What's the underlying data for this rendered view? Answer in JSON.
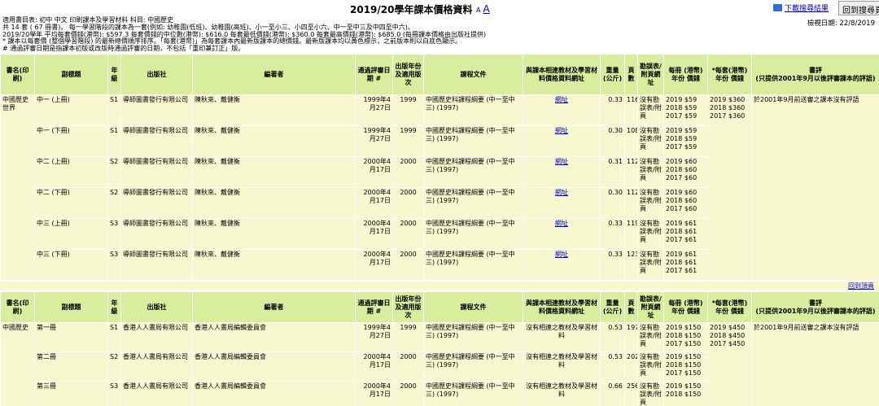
{
  "header": {
    "title": "2019/20學年課本價格資料",
    "font_small": "A",
    "font_large": "A",
    "download_label": "下載搜尋結果",
    "back_label": "回到搜尋頁",
    "check_date": "檢視日期: 22/8/2019"
  },
  "info": {
    "line1": "適用書目表:  初中 中文 印刷課本及學習材料     科目:  中國歷史",
    "line2": "共 14 套 ( 67 冊書)。     每一學習階段的課本為一套(例如: 幼稚園(低班)、幼稚園(高班)、小一至小三、小四至小六、中一至中三及中四至中六)。",
    "line3": "2019/20學年 平均每套價錢(港幣): $597.3     每套價錢的中位數(港幣): $616.0     每套最低價錢(港幣): $360.0     每套最高價錢(港幣): $685.0     (每冊課本價格由出版社提供)",
    "line4": "* 課本以每套價 (整個學習階段) 的最新總價順序排序。「每套(港幣)」為每套課本內最新版課本的總價錢。最新版課本均以黃色標示，之前版本則以白底色顯示。",
    "line5": "# 通過評審日期是指課本初版或改版時通過評審的日期，不包括「重印兼訂正」版。"
  },
  "columns": [
    "書名(印刷)",
    "副標題",
    "年級",
    "出版社",
    "編著者",
    "通過評審日期 #",
    "出版年份及適用版次",
    "課程文件",
    "與課本相連教材及學習材料價格資料網址",
    "重量(公斤)",
    "頁數",
    "勘誤表/附頁網址",
    "每冊 (港幣)",
    "年份",
    "價錢",
    "*每套(港幣)",
    "年份",
    "價錢",
    "書評\n(只提供2001年9月以後評審課本的評語)"
  ],
  "table1": {
    "book": "中國歷史世界",
    "review": "於2001年9月前送審之課本沒有評語",
    "set_prices": [
      [
        "2019",
        "$360"
      ],
      [
        "2018",
        "$360"
      ],
      [
        "2017",
        "$360"
      ]
    ],
    "rows": [
      {
        "sub": "中一 (上冊)",
        "grade": "S1",
        "pub": "導師圖書發行有限公司",
        "author": "陳秋來、戴健衡",
        "date": "1999年4月27日",
        "year": "1999",
        "curr": "中國歷史科課程綱要 (中一至中三) (1997)",
        "link": "網址",
        "weight": "0.33",
        "pages": "116",
        "err": "沒有勘誤表/附頁",
        "prices": [
          [
            "2019",
            "$59"
          ],
          [
            "2018",
            "$59"
          ],
          [
            "2017",
            "$59"
          ]
        ]
      },
      {
        "sub": "中一 (下冊)",
        "grade": "S1",
        "pub": "導師圖書發行有限公司",
        "author": "陳秋來、戴健衡",
        "date": "1999年4月27日",
        "year": "1999",
        "curr": "中國歷史科課程綱要 (中一至中三) (1997)",
        "link": "網址",
        "weight": "0.30",
        "pages": "108",
        "err": "沒有勘誤表/附頁",
        "prices": [
          [
            "2019",
            "$59"
          ],
          [
            "2018",
            "$59"
          ],
          [
            "2017",
            "$59"
          ]
        ]
      },
      {
        "sub": "中二 (上冊)",
        "grade": "S2",
        "pub": "導師圖書發行有限公司",
        "author": "陳秋來、戴健衡",
        "date": "2000年4月17日",
        "year": "2000",
        "curr": "中國歷史科課程綱要 (中一至中三) (1997)",
        "link": "網址",
        "weight": "0.31",
        "pages": "112",
        "err": "沒有勘誤表/附頁",
        "prices": [
          [
            "2019",
            "$60"
          ],
          [
            "2018",
            "$60"
          ],
          [
            "2017",
            "$60"
          ]
        ]
      },
      {
        "sub": "中二 (下冊)",
        "grade": "S2",
        "pub": "導師圖書發行有限公司",
        "author": "陳秋來、戴健衡",
        "date": "2000年4月17日",
        "year": "2000",
        "curr": "中國歷史科課程綱要 (中一至中三) (1997)",
        "link": "網址",
        "weight": "0.30",
        "pages": "112",
        "err": "沒有勘誤表/附頁",
        "prices": [
          [
            "2019",
            "$60"
          ],
          [
            "2018",
            "$60"
          ],
          [
            "2017",
            "$60"
          ]
        ]
      },
      {
        "sub": "中三 (上冊)",
        "grade": "S3",
        "pub": "導師圖書發行有限公司",
        "author": "陳秋來、戴健衡",
        "date": "2000年4月17日",
        "year": "2000",
        "curr": "中國歷史科課程綱要 (中一至中三) (1997)",
        "link": "網址",
        "weight": "0.33",
        "pages": "119",
        "err": "沒有勘誤表/附頁",
        "prices": [
          [
            "2019",
            "$61"
          ],
          [
            "2018",
            "$61"
          ],
          [
            "2017",
            "$61"
          ]
        ]
      },
      {
        "sub": "中三 (下冊)",
        "grade": "S3",
        "pub": "導師圖書發行有限公司",
        "author": "陳秋來、戴健衡",
        "date": "2000年4月17日",
        "year": "2000",
        "curr": "中國歷史科課程綱要 (中一至中三) (1997)",
        "link": "網址",
        "weight": "0.33",
        "pages": "123",
        "err": "沒有勘誤表/附頁",
        "prices": [
          [
            "2019",
            "$61"
          ],
          [
            "2018",
            "$61"
          ],
          [
            "2017",
            "$61"
          ]
        ]
      }
    ]
  },
  "back_to_top": "回到頂頁",
  "table2": {
    "book": "中國歷史",
    "review": "於2001年9月前送審之課本沒有評語",
    "set_prices": [
      [
        "2019",
        "$450"
      ],
      [
        "2018",
        "$450"
      ],
      [
        "2017",
        "$450"
      ]
    ],
    "rows": [
      {
        "sub": "第一冊",
        "grade": "S1",
        "pub": "香港人人書局有限公司",
        "author": "香港人人書局編輯委員會",
        "date": "1999年4月27日",
        "year": "1999",
        "curr": "中國歷史科課程綱要 (中一至中三) (1997)",
        "link": "沒有相連之教材及學習材料",
        "weight": "0.53",
        "pages": "197",
        "err": "沒有勘誤表/附頁",
        "prices": [
          [
            "2019",
            "$150"
          ],
          [
            "2018",
            "$150"
          ],
          [
            "2017",
            "$150"
          ]
        ]
      },
      {
        "sub": "第二冊",
        "grade": "S2",
        "pub": "香港人人書局有限公司",
        "author": "香港人人書局編輯委員會",
        "date": "2000年4月17日",
        "year": "2000",
        "curr": "中國歷史科課程綱要 (中一至中三) (1997)",
        "link": "沒有相連之教材及學習材料",
        "weight": "0.53",
        "pages": "202",
        "err": "沒有勘誤表/附頁",
        "prices": [
          [
            "2019",
            "$150"
          ],
          [
            "2018",
            "$150"
          ],
          [
            "2017",
            "$150"
          ]
        ]
      },
      {
        "sub": "第三冊",
        "grade": "S3",
        "pub": "香港人人書局有限公司",
        "author": "香港人人書局編輯委員會",
        "date": "2000年4月17日",
        "year": "2000",
        "curr": "中國歷史科課程綱要 (中一至中三) (1997)",
        "link": "沒有相連之教材及學習材料",
        "weight": "0.66",
        "pages": "256",
        "err": "沒有勘誤表/附頁",
        "prices": [
          [
            "2019",
            "$150"
          ],
          [
            "2018",
            "$150"
          ]
        ]
      }
    ]
  }
}
